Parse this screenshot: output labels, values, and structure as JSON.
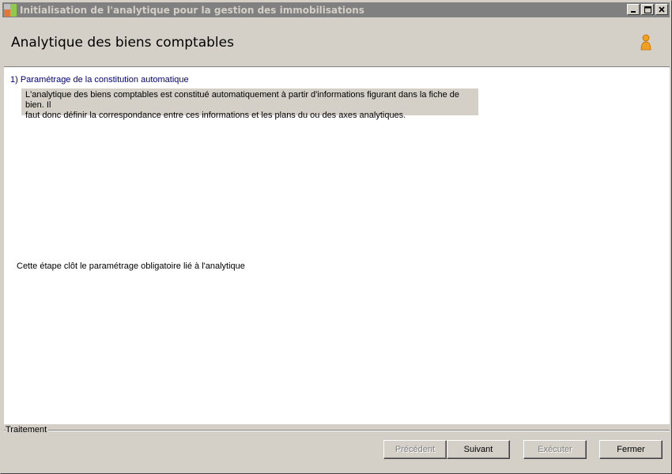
{
  "window": {
    "title": "Initialisation de l'analytique pour la gestion des immobilisations",
    "minimize_glyph": "_",
    "maximize_glyph": "□",
    "close_glyph": "×"
  },
  "header": {
    "title": "Analytique des biens comptables",
    "icon": "user-icon"
  },
  "content": {
    "step_heading": "1) Paramétrage de la constitution automatique",
    "description_line1": "L'analytique des biens comptables est constitué automatiquement à partir d'informations figurant dans la fiche de bien. Il",
    "description_line2": "faut donc définir la correspondance entre ces informations et les plans du ou des axes analytiques.",
    "closing_note": "Cette étape clôt le paramétrage obligatoire lié à l'analytique"
  },
  "footer": {
    "group_label": "Traitement",
    "buttons": {
      "previous": "Précédent",
      "next": "Suivant",
      "execute": "Exécuter",
      "close": "Fermer"
    }
  },
  "colors": {
    "titlebar_bg": "#808080",
    "window_bg": "#d4d0c8",
    "heading_color": "#000080",
    "user_icon": "#f0a020"
  }
}
